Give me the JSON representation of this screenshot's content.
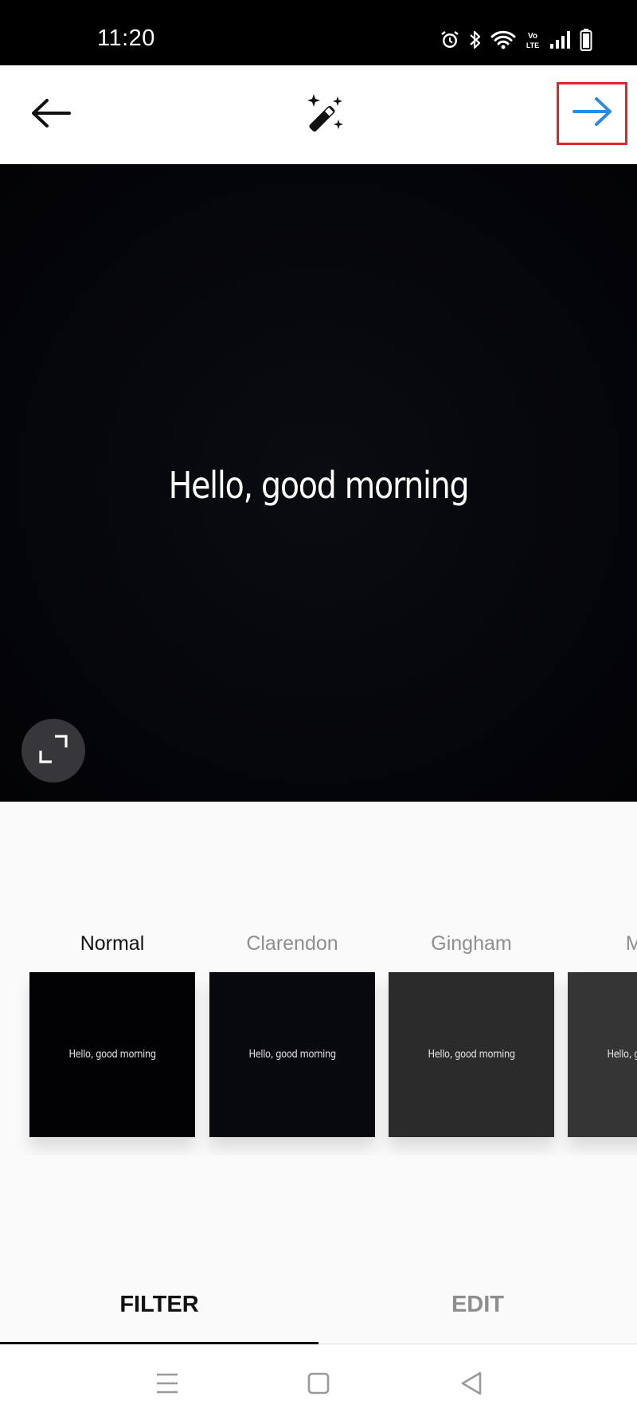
{
  "status_bar": {
    "time": "11:20",
    "icons": [
      "alarm-icon",
      "bluetooth-icon",
      "wifi-icon",
      "volte-icon",
      "signal-icon",
      "battery-icon"
    ],
    "volte_label": "Vo\nLTE"
  },
  "top_bar": {
    "back_icon": "arrow-left-icon",
    "magic_icon": "magic-wand-icon",
    "next_icon": "arrow-right-icon",
    "next_color": "#2d8ae0",
    "highlight_color": "#e1262b"
  },
  "preview": {
    "text": "Hello, good morning",
    "expand_icon": "expand-icon"
  },
  "filters": [
    {
      "label": "Normal",
      "thumb_text": "Hello, good morning",
      "selected": true
    },
    {
      "label": "Clarendon",
      "thumb_text": "Hello, good morning",
      "selected": false
    },
    {
      "label": "Gingham",
      "thumb_text": "Hello, good morning",
      "selected": false
    },
    {
      "label": "Moon",
      "thumb_text": "Hello, good morning",
      "selected": false
    }
  ],
  "tabs": {
    "filter": "FILTER",
    "edit": "EDIT",
    "active": "filter"
  },
  "nav_bar": {
    "icons": [
      "menu-icon",
      "home-square-icon",
      "back-triangle-icon"
    ]
  }
}
